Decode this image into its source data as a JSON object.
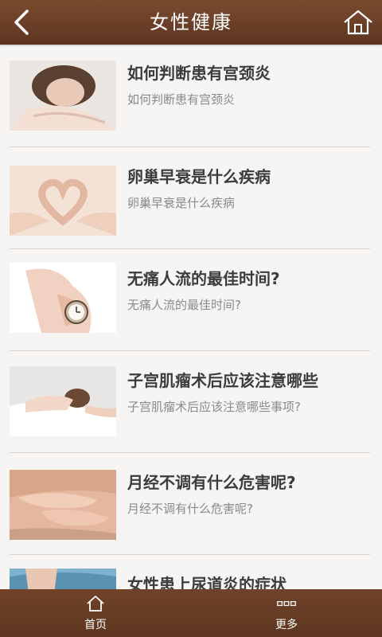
{
  "header": {
    "title": "女性健康",
    "back_icon": "back-arrow-icon",
    "home_icon": "home-icon"
  },
  "articles": [
    {
      "title": "如何判断患有宫颈炎",
      "subtitle": "如何判断患有宫颈炎"
    },
    {
      "title": "卵巢早衰是什么疾病",
      "subtitle": "卵巢早衰是什么疾病"
    },
    {
      "title": "无痛人流的最佳时间?",
      "subtitle": "无痛人流的最佳时间?"
    },
    {
      "title": "子宫肌瘤术后应该注意哪些",
      "subtitle": "子宫肌瘤术后应该注意哪些事项?"
    },
    {
      "title": "月经不调有什么危害呢?",
      "subtitle": "月经不调有什么危害呢?"
    },
    {
      "title": "女性患上尿道炎的症状",
      "subtitle": ""
    }
  ],
  "bottom_nav": {
    "home_label": "首页",
    "home_icon": "home-outline-icon",
    "more_label": "更多",
    "more_icon": "grid-dots-icon"
  },
  "colors": {
    "bar_brown": "#6b3f27",
    "background": "#f7f5f3",
    "title_text": "#3c3c3c",
    "subtitle_text": "#8a8a8a"
  }
}
